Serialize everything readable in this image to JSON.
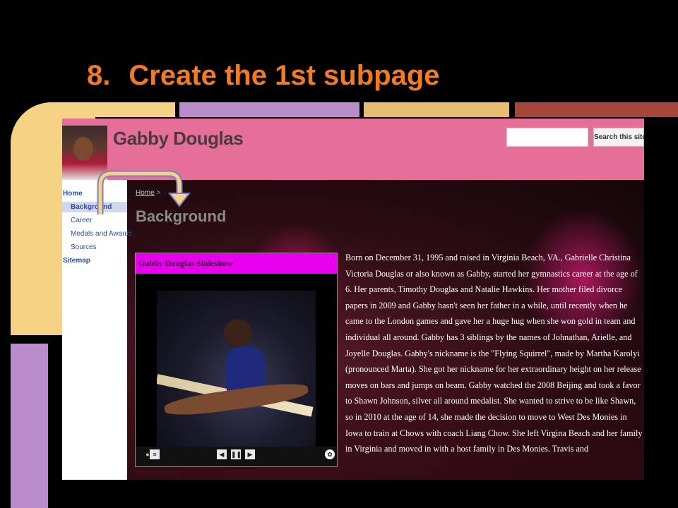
{
  "slide": {
    "number": "8.",
    "title": "Create the 1st subpage"
  },
  "site": {
    "name": "Gabby Douglas",
    "search_button": "Search this site",
    "search_placeholder": ""
  },
  "sidebar": {
    "items": [
      {
        "label": "Home"
      },
      {
        "label": "Background"
      },
      {
        "label": "Career"
      },
      {
        "label": "Medals and Awards"
      },
      {
        "label": "Sources"
      },
      {
        "label": "Sitemap"
      }
    ]
  },
  "breadcrumb": {
    "home": "Home",
    "separator": ">"
  },
  "page": {
    "heading": "Background"
  },
  "slideshow": {
    "title": "Gabby Douglas Slideshow"
  },
  "bio": "Born on December 31, 1995 and raised in Virginia Beach, VA., Gabrielle Christina Victoria Douglas or also known as Gabby, started her gymnastics career at the age of 6. Her parents, Timothy Douglas and Natalie Hawkins. Her mother filed divorce papers in 2009 and Gabby hasn't seen her father in a while, until recently when he came to the London games and gave her a huge hug when she won gold in team and individual all around. Gabby has 3 siblings by the names of Johnathan, Arielle, and Joyelle Douglas. Gabby's nickname is the \"Flying Squirrel\", made by Martha Karolyi (pronounced Marta). She got her nickname for her extraordinary height on her release moves on bars and jumps on beam. Gabby watched the 2008 Beijing and took a favor to Shawn Johnson, silver all around medalist. She wanted to strive to be like Shawn, so in 2010 at the age of 14, she made the decision to move to West Des Monies in Iowa to train at Chows with coach Liang Chow. She left Virgina Beach and her family in Virginia and moved in with a host family in Des Monies. Travis and",
  "colors": {
    "title": "#f47b20",
    "header": "#e56f98",
    "slideshow_title": "#e800ee"
  }
}
